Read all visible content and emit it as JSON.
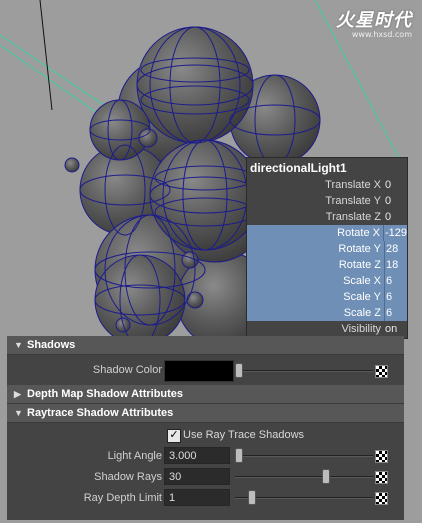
{
  "watermark": {
    "logo": "火星时代",
    "url": "www.hxsd.com"
  },
  "channel_box": {
    "title": "directionalLight1",
    "rows": [
      {
        "label": "Translate X",
        "value": "0",
        "selected": false
      },
      {
        "label": "Translate Y",
        "value": "0",
        "selected": false
      },
      {
        "label": "Translate Z",
        "value": "0",
        "selected": false
      },
      {
        "label": "Rotate X",
        "value": "-129",
        "selected": true
      },
      {
        "label": "Rotate Y",
        "value": "28",
        "selected": true
      },
      {
        "label": "Rotate Z",
        "value": "18",
        "selected": true
      },
      {
        "label": "Scale X",
        "value": "6",
        "selected": true
      },
      {
        "label": "Scale Y",
        "value": "6",
        "selected": true
      },
      {
        "label": "Scale Z",
        "value": "6",
        "selected": true
      },
      {
        "label": "Visibility",
        "value": "on",
        "selected": false
      }
    ]
  },
  "attribute_editor": {
    "shadows": {
      "header": "Shadows",
      "shadow_color_label": "Shadow Color",
      "shadow_color": "#000000",
      "shadow_color_slider": 0.0
    },
    "depth_map": {
      "header": "Depth Map Shadow Attributes"
    },
    "raytrace": {
      "header": "Raytrace Shadow Attributes",
      "use_ray_trace_label": "Use Ray Trace Shadows",
      "use_ray_trace_checked": true,
      "check_mark": "✓",
      "light_angle_label": "Light Angle",
      "light_angle_value": "3.000",
      "light_angle_slider": 0.0,
      "shadow_rays_label": "Shadow Rays",
      "shadow_rays_value": "30",
      "shadow_rays_slider": 0.67,
      "ray_depth_label": "Ray Depth Limit",
      "ray_depth_value": "1",
      "ray_depth_slider": 0.1
    }
  },
  "colors": {
    "selection": "#6f8fb7",
    "viewport_bg": "#9d9d9d",
    "wireframe": "#1c1c8c",
    "light_line": "#3fd0a8"
  }
}
